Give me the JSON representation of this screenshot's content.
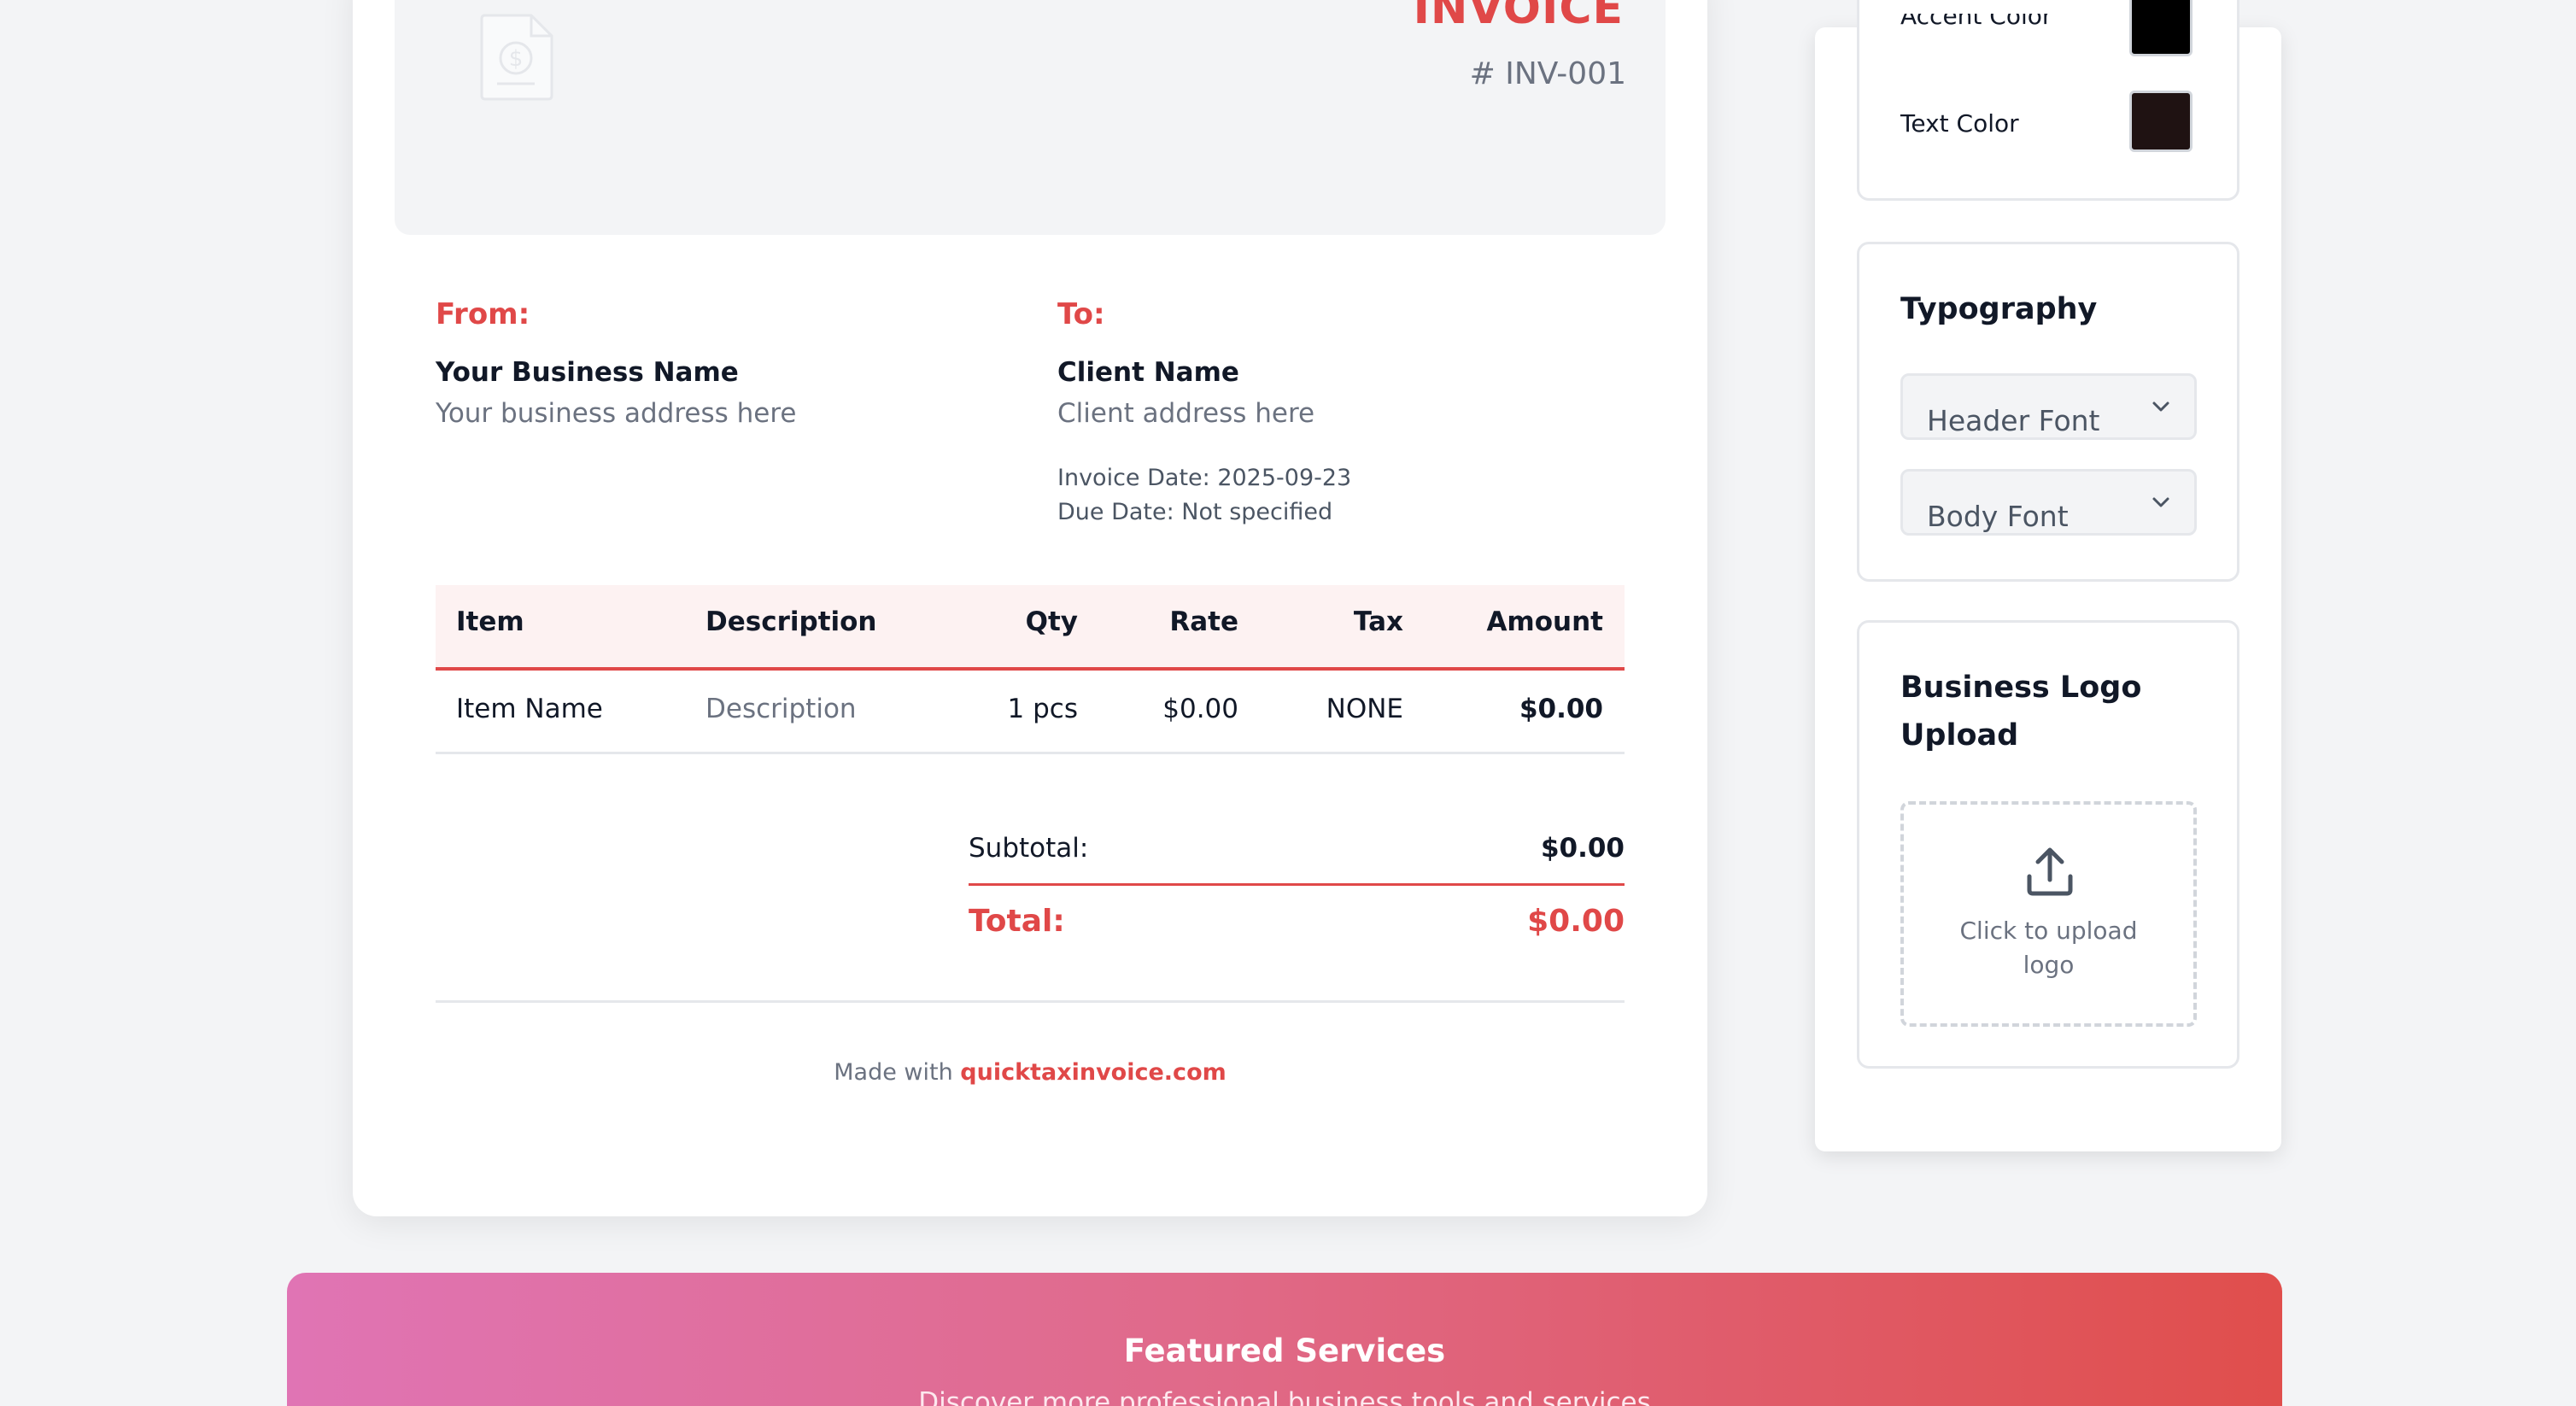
{
  "invoice": {
    "title": "INVOICE",
    "number": "# INV-001",
    "from_label": "From:",
    "from_name": "Your Business Name",
    "from_address": "Your business address here",
    "to_label": "To:",
    "to_name": "Client Name",
    "to_address": "Client address here",
    "invoice_date": "Invoice Date: 2025-09-23",
    "due_date": "Due Date: Not specified",
    "table": {
      "headers": [
        "Item",
        "Description",
        "Qty",
        "Rate",
        "Tax",
        "Amount"
      ],
      "rows": [
        [
          "Item Name",
          "Description",
          "1 pcs",
          "$0.00",
          "NONE",
          "$0.00"
        ]
      ]
    },
    "subtotal_label": "Subtotal:",
    "subtotal_value": "$0.00",
    "total_label": "Total:",
    "total_value": "$0.00",
    "footer_prefix": "Made with",
    "footer_link": "quicktaxinvoice.com"
  },
  "settings": {
    "accent_label": "Accent Color",
    "accent_color": "#000000",
    "text_label": "Text Color",
    "text_color": "#1f1212",
    "typography_title": "Typography",
    "header_font_placeholder": "Header Font",
    "body_font_placeholder": "Body Font",
    "logo_title_line1": "Business Logo",
    "logo_title_line2": "Upload",
    "upload_line1": "Click to upload",
    "upload_line2": "logo"
  },
  "banner": {
    "title": "Featured Services",
    "subtitle": "Discover more professional business tools and services"
  },
  "colors": {
    "accent_red": "#e04848",
    "banner_start": "#e074b4",
    "banner_end": "#e04e4c"
  },
  "icons": [
    "document-dollar-icon",
    "chevron-down-icon",
    "upload-icon"
  ]
}
